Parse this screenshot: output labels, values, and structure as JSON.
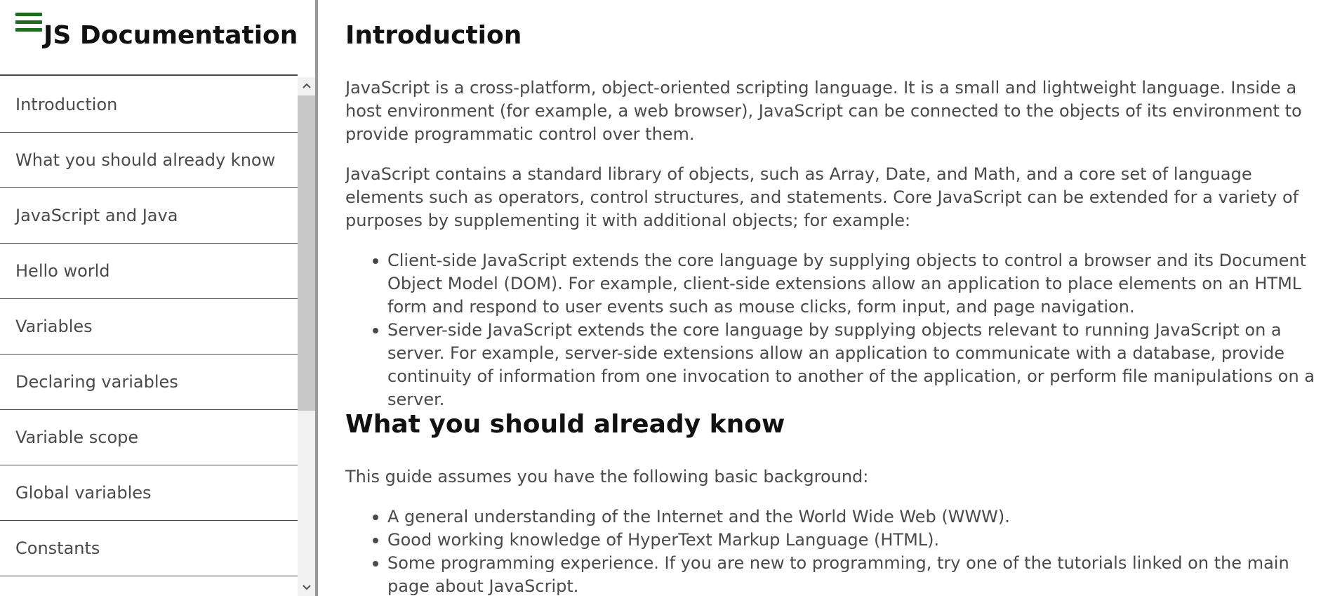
{
  "sidebar": {
    "title": "JS Documentation",
    "menu_icon": "hamburger-menu-icon",
    "items": [
      {
        "label": "Introduction"
      },
      {
        "label": "What you should already know"
      },
      {
        "label": "JavaScript and Java"
      },
      {
        "label": "Hello world"
      },
      {
        "label": "Variables"
      },
      {
        "label": "Declaring variables"
      },
      {
        "label": "Variable scope"
      },
      {
        "label": "Global variables"
      },
      {
        "label": "Constants"
      }
    ]
  },
  "scrollbar": {
    "up_icon": "chevron-up-icon",
    "down_icon": "chevron-down-icon"
  },
  "main": {
    "sections": [
      {
        "title": "Introduction",
        "paragraphs": [
          "JavaScript is a cross-platform, object-oriented scripting language. It is a small and lightweight language. Inside a host environment (for example, a web browser), JavaScript can be connected to the objects of its environment to provide programmatic control over them.",
          "JavaScript contains a standard library of objects, such as Array, Date, and Math, and a core set of language elements such as operators, control structures, and statements. Core JavaScript can be extended for a variety of purposes by supplementing it with additional objects; for example:"
        ],
        "bullets": [
          "Client-side JavaScript extends the core language by supplying objects to control a browser and its Document Object Model (DOM). For example, client-side extensions allow an application to place elements on an HTML form and respond to user events such as mouse clicks, form input, and page navigation.",
          "Server-side JavaScript extends the core language by supplying objects relevant to running JavaScript on a server. For example, server-side extensions allow an application to communicate with a database, provide continuity of information from one invocation to another of the application, or perform file manipulations on a server."
        ]
      },
      {
        "title": "What you should already know",
        "paragraphs": [
          "This guide assumes you have the following basic background:"
        ],
        "bullets": [
          "A general understanding of the Internet and the World Wide Web (WWW).",
          "Good working knowledge of HyperText Markup Language (HTML).",
          "Some programming experience. If you are new to programming, try one of the tutorials linked on the main page about JavaScript."
        ]
      }
    ]
  },
  "colors": {
    "accent": "#1e6b1e",
    "text": "#4a4a4a",
    "heading": "#111111",
    "divider": "#999999"
  }
}
